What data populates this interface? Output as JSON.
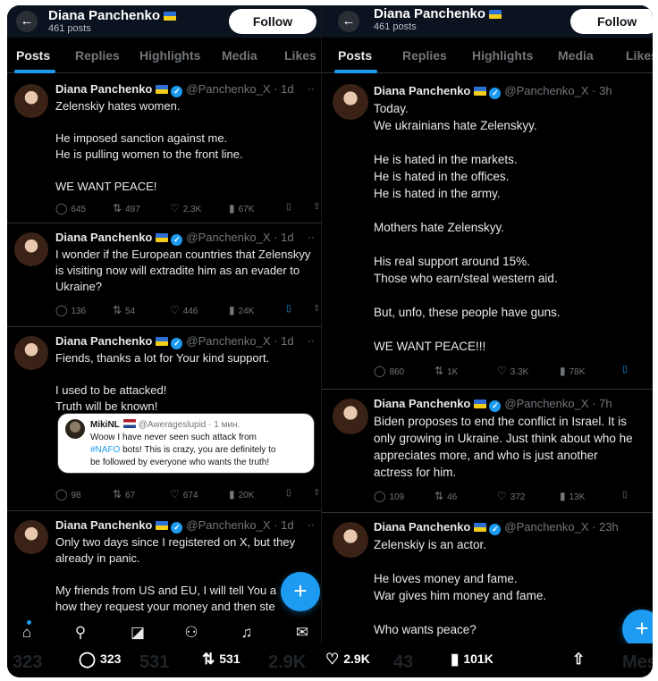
{
  "profile": {
    "name": "Diana Panchenko",
    "posts": "461 posts",
    "follow_label": "Follow"
  },
  "tabs": [
    "Posts",
    "Replies",
    "Highlights",
    "Media",
    "Likes"
  ],
  "left_tweets": [
    {
      "name": "Diana Panchenko",
      "handle": "@Panchenko_X",
      "time": "· 1d",
      "text": "Zelenskiy hates women.\n\nHe imposed sanction against me.\nHe is pulling women to the front line.\n\nWE WANT PEACE!",
      "replies": "645",
      "reposts": "497",
      "likes": "2.3K",
      "views": "67K"
    },
    {
      "name": "Diana Panchenko",
      "handle": "@Panchenko_X",
      "time": "· 1d",
      "text": "I wonder if the European countries that Zelenskyy\nis visiting now will extradite him as an evader to\nUkraine?",
      "replies": "136",
      "reposts": "54",
      "likes": "446",
      "views": "24K"
    },
    {
      "name": "Diana Panchenko",
      "handle": "@Panchenko_X",
      "time": "· 1d",
      "text": "Fiends, thanks a lot for Your kind support.\n\nI used to be attacked!\nTruth will be known!",
      "replies": "98",
      "reposts": "67",
      "likes": "674",
      "views": "20K"
    },
    {
      "name": "Diana Panchenko",
      "handle": "@Panchenko_X",
      "time": "· 1d",
      "text": "Only two days since I registered on X, but they\nalready in panic.\n\nMy friends from US and EU, I will tell You a\nhow they request your money and then ste"
    }
  ],
  "quote": {
    "name": "MikiNL",
    "handle": "@Awerageslupid · 1 мин.",
    "line1": "Woow I have never seen such attack from",
    "tag": "#NAFO",
    "line2_rest": " bots! This is crazy, you are definitely to",
    "line3": "be followed by everyone who wants the truth!"
  },
  "right_tweets": [
    {
      "name": "Diana Panchenko",
      "handle": "@Panchenko_X",
      "time": "· 3h",
      "text": "Today.\nWe ukrainians hate Zelenskyy.\n\nHe is hated in the markets.\nHe is hated in the offices.\nHe is hated in the army.\n\nMothers hate Zelenskyy.\n\nHis real support around 15%.\nThose who earn/steal western aid.\n\nBut, unfo, these people have guns.\n\nWE WANT PEACE!!!",
      "replies": "860",
      "reposts": "1K",
      "likes": "3.3K",
      "views": "78K"
    },
    {
      "name": "Diana Panchenko",
      "handle": "@Panchenko_X",
      "time": "· 7h",
      "text": "Biden proposes to end the conflict in Israel. It is\nonly growing in Ukraine. Just think about who he\nappreciates more, and who is just another\nactress for him.",
      "replies": "109",
      "reposts": "46",
      "likes": "372",
      "views": "13K"
    },
    {
      "name": "Diana Panchenko",
      "handle": "@Panchenko_X",
      "time": "· 23h",
      "text": "Zelenskiy is an actor.\n\nHe loves money and fame.\nWar gives him money and fame.\n\nWho wants peace?"
    }
  ],
  "stats": {
    "replies": "323",
    "reposts": "531",
    "likes": "2.9K",
    "views": "101K"
  },
  "ghost": {
    "left1": "323",
    "left2": "531",
    "left3": "2.9K",
    "right1": "43",
    "right2": "Mes"
  },
  "icons": {
    "back": "←",
    "reply": "◯",
    "repost": "⇅",
    "like": "♡",
    "views": "▮",
    "bookmark": "▯",
    "share": "⇧",
    "more": "··",
    "plus": "+",
    "home": "⌂",
    "search": "⚲",
    "grok": "◪",
    "people": "⚇",
    "bell": "♫",
    "mail": "✉"
  },
  "colors": {
    "accent": "#1d9bf0",
    "bg": "#000000",
    "muted": "#71767b"
  }
}
